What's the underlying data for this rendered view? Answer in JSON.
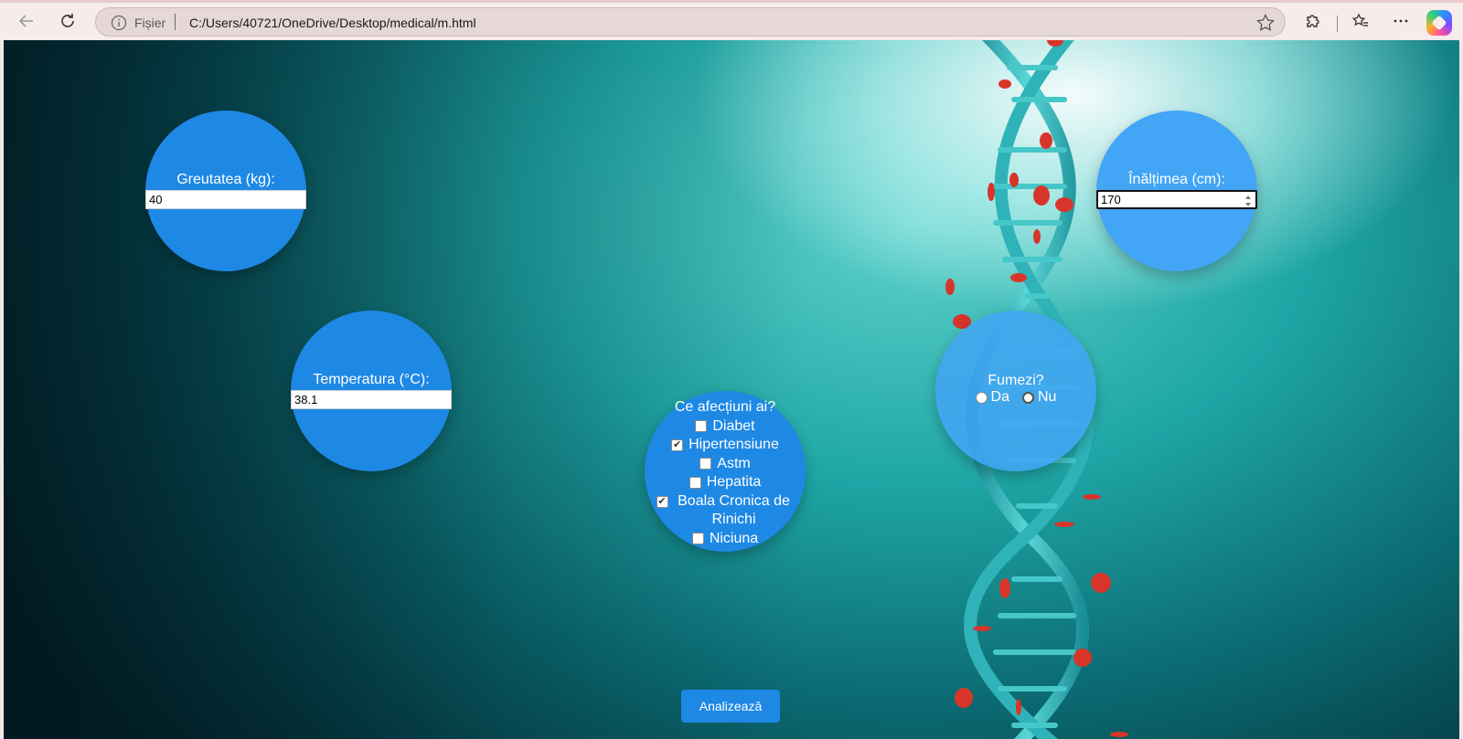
{
  "browser": {
    "scheme_label": "Fișier",
    "url": "C:/Users/40721/OneDrive/Desktop/medical/m.html"
  },
  "form": {
    "weight": {
      "label": "Greutatea (kg):",
      "value": "40"
    },
    "height": {
      "label": "Înălțimea (cm):",
      "value": "170"
    },
    "temperature": {
      "label": "Temperatura (°C):",
      "value": "38.1"
    },
    "smoking": {
      "question": "Fumezi?",
      "options": [
        "Da",
        "Nu"
      ],
      "selected": "Nu"
    },
    "conditions": {
      "question": "Ce afecțiuni ai?",
      "items": [
        {
          "label": "Diabet",
          "checked": false
        },
        {
          "label": "Hipertensiune",
          "checked": true
        },
        {
          "label": "Astm",
          "checked": false
        },
        {
          "label": "Hepatita",
          "checked": false
        },
        {
          "label": "Boala Cronica de Rinichi",
          "checked": true
        },
        {
          "label": "Niciuna",
          "checked": false
        }
      ]
    },
    "submit_label": "Analizează"
  },
  "colors": {
    "circle": "#1e88e5",
    "circle_light": "#42a5f5",
    "accent_button": "#1e88e5"
  }
}
